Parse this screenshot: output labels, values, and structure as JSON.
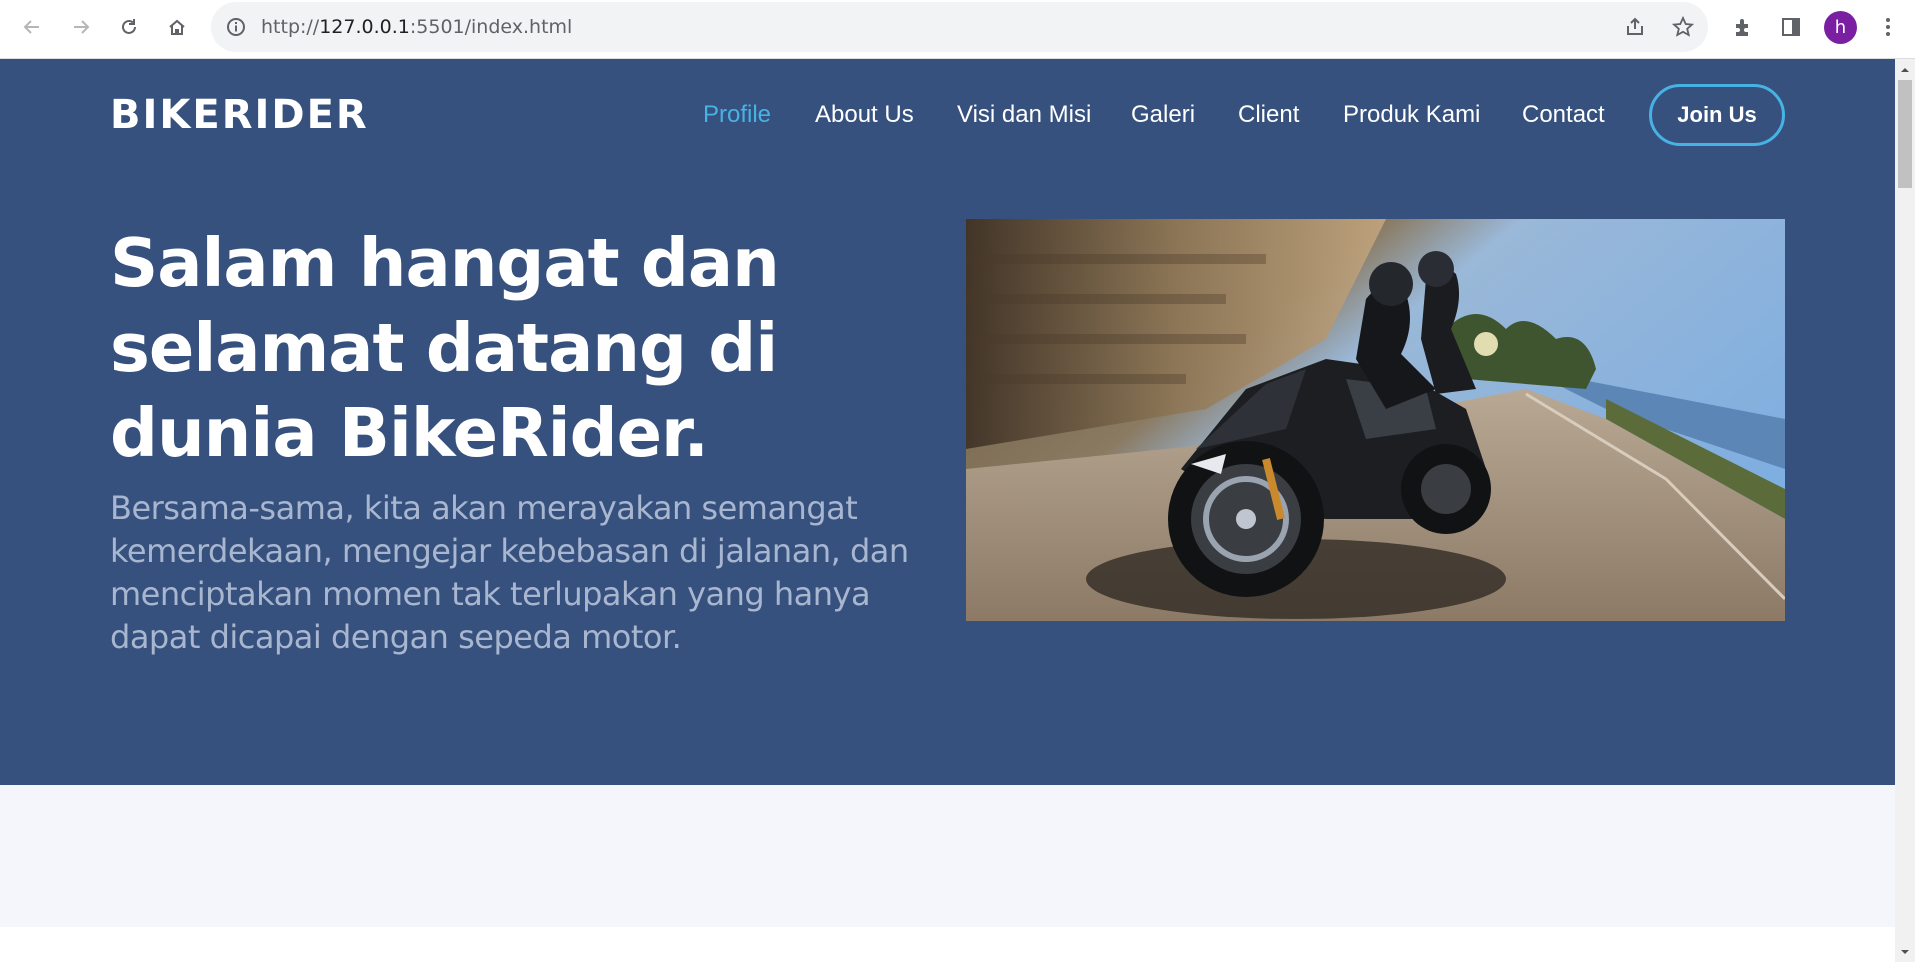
{
  "browser": {
    "url_scheme": "http://",
    "url_host": "127.0.0.1",
    "url_rest": ":5501/index.html",
    "profile_initial": "h",
    "icons": [
      "back-icon",
      "forward-icon",
      "reload-icon",
      "home-icon",
      "info-icon",
      "share-icon",
      "bookmark-star-icon",
      "extensions-icon",
      "side-panel-icon",
      "more-menu-icon"
    ]
  },
  "site": {
    "logo": "BIKERIDER",
    "nav": {
      "profile": "Profile",
      "about": "About Us",
      "visi": "Visi dan Misi",
      "galeri": "Galeri",
      "client": "Client",
      "produk": "Produk Kami",
      "contact": "Contact",
      "join": "Join Us"
    },
    "hero": {
      "headline": "Salam hangat dan selamat datang di dunia BikeRider.",
      "subtext": "Bersama-sama, kita akan merayakan semangat kemerdekaan, mengejar kebebasan di jalanan, dan menciptakan momen tak terlupakan yang hanya dapat dicapai dengan sepeda motor."
    }
  },
  "colors": {
    "hero_bg": "#36517e",
    "accent": "#47b2e4",
    "subtext": "#a9b6cf",
    "section_bg": "#f4f6fb"
  }
}
